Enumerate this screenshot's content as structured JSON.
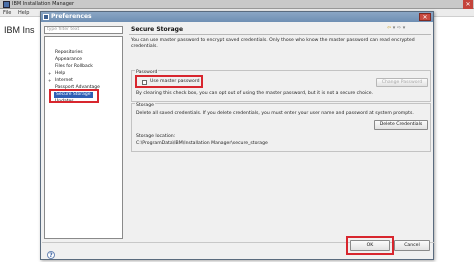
{
  "main_window": {
    "title": "IBM Installation Manager",
    "menu": [
      "File",
      "Help"
    ],
    "brand_text": "IBM Ins"
  },
  "dialog": {
    "title": "Preferences",
    "filter_placeholder": "type filter text",
    "tree": [
      {
        "label": "Repositories",
        "indent": 1,
        "selected": false
      },
      {
        "label": "Appearance",
        "indent": 1,
        "selected": false
      },
      {
        "label": "Files for Rollback",
        "indent": 1,
        "selected": false
      },
      {
        "label": "Help",
        "indent": 0,
        "expander": "+",
        "selected": false
      },
      {
        "label": "Internet",
        "indent": 0,
        "expander": "+",
        "selected": false
      },
      {
        "label": "Passport Advantage",
        "indent": 1,
        "selected": false
      },
      {
        "label": "Secure Storage",
        "indent": 1,
        "selected": true
      },
      {
        "label": "Updates",
        "indent": 1,
        "selected": false
      }
    ],
    "panel": {
      "title": "Secure Storage",
      "description": "You can use master password to encrypt saved credentials. Only those who know the master password can read encrypted credentials.",
      "password_group": {
        "label": "Password",
        "checkbox_label": "Use master password",
        "checkbox_checked": false,
        "note": "By clearing this check box, you can opt out of using the master password, but it is not a secure choice.",
        "change_button": "Change Password"
      },
      "storage_group": {
        "label": "Storage",
        "description": "Delete all saved credentials. If you delete credentials, you must enter your user name and password at system prompts.",
        "delete_button": "Delete Credentials",
        "location_label": "Storage location:",
        "location_value": "C:\\ProgramData\\IBM\\Installation Manager\\secure_storage"
      }
    },
    "buttons": {
      "ok": "OK",
      "cancel": "Cancel"
    },
    "highlight_color": "#d8262e",
    "selection_color": "#2f5fb5"
  }
}
